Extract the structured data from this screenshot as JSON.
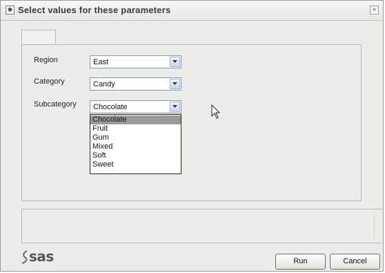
{
  "window": {
    "title": "Select values for these parameters",
    "close_glyph": "×"
  },
  "form": {
    "fields": [
      {
        "label": "Region",
        "value": "East"
      },
      {
        "label": "Category",
        "value": "Candy"
      },
      {
        "label": "Subcategory",
        "value": "Chocolate"
      }
    ],
    "subcategory_options": [
      "Chocolate",
      "Fruit",
      "Gum",
      "Mixed",
      "Soft",
      "Sweet"
    ],
    "subcategory_highlighted": "Chocolate"
  },
  "footer": {
    "logo_text": "sas",
    "run_label": "Run",
    "cancel_label": "Cancel"
  },
  "colors": {
    "window_bg": "#ecece9",
    "combo_border": "#7f9db9",
    "highlight": "#9a9a9a"
  },
  "icons": {
    "app": "app-icon",
    "close": "close-icon",
    "dropdown": "chevron-down-icon",
    "pointer": "mouse-pointer-icon",
    "logo": "sas-logo"
  }
}
